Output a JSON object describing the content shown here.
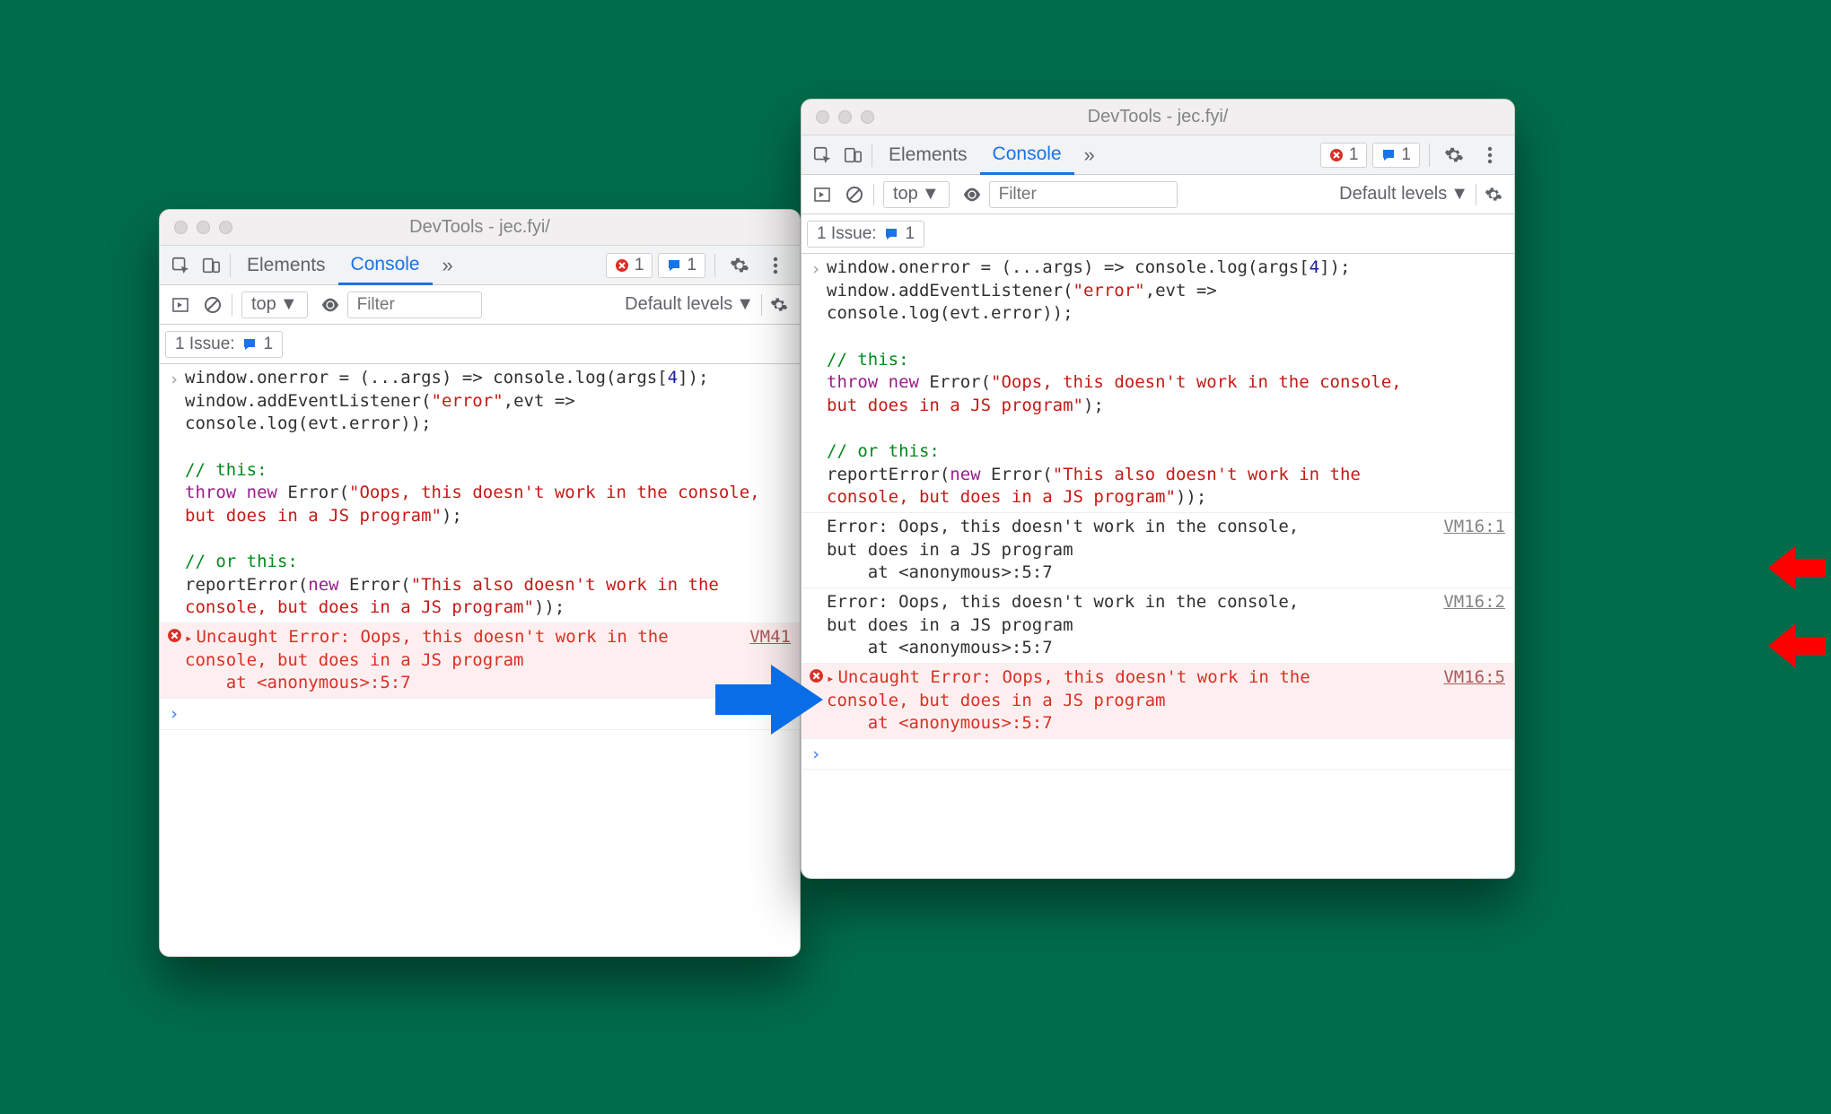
{
  "windowLeft": {
    "title": "DevTools - jec.fyi/",
    "tabs": {
      "elements": "Elements",
      "console": "Console"
    },
    "badges": {
      "errors": "1",
      "msgs": "1"
    },
    "filter": {
      "context": "top",
      "placeholder": "Filter",
      "levels": "Default levels"
    },
    "issues": {
      "label": "1 Issue:",
      "count": "1"
    },
    "code": {
      "l1a": "window.onerror = (...args) => console.log(args[",
      "l1n": "4",
      "l1b": "]);",
      "l2a": "window.addEventListener(",
      "l2s": "\"error\"",
      "l2b": ",evt =>",
      "l3": "console.log(evt.error));",
      "c1": "// this:",
      "t1a": "throw",
      "t1b": " new",
      "t1c": " Error(",
      "t1s": "\"Oops, this doesn't work in the console,\nbut does in a JS program\"",
      "t1d": ");",
      "c2": "// or this:",
      "r1a": "reportError(",
      "r1b": "new",
      "r1c": " Error(",
      "r1s": "\"This also doesn't work in the\nconsole, but does in a JS program\"",
      "r1d": "));"
    },
    "error": {
      "msg": "Uncaught Error: Oops, this doesn't work in the\nconsole, but does in a JS program\n    at <anonymous>:5:7",
      "src": "VM41"
    }
  },
  "windowRight": {
    "title": "DevTools - jec.fyi/",
    "tabs": {
      "elements": "Elements",
      "console": "Console"
    },
    "badges": {
      "errors": "1",
      "msgs": "1"
    },
    "filter": {
      "context": "top",
      "placeholder": "Filter",
      "levels": "Default levels"
    },
    "issues": {
      "label": "1 Issue:",
      "count": "1"
    },
    "logs": [
      {
        "msg": "Error: Oops, this doesn't work in the console,\nbut does in a JS program\n    at <anonymous>:5:7",
        "src": "VM16:1"
      },
      {
        "msg": "Error: Oops, this doesn't work in the console,\nbut does in a JS program\n    at <anonymous>:5:7",
        "src": "VM16:2"
      }
    ],
    "error": {
      "msg": "Uncaught Error: Oops, this doesn't work in the\nconsole, but does in a JS program\n    at <anonymous>:5:7",
      "src": "VM16:5"
    }
  }
}
